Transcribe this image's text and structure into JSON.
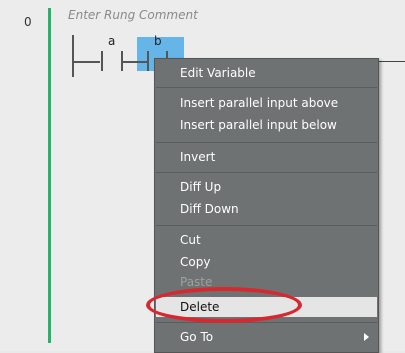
{
  "ladder": {
    "rung_number": "0",
    "rung_comment_placeholder": "Enter Rung Comment",
    "contact_a_label": "a",
    "contact_b_label": "b"
  },
  "context_menu": {
    "items": [
      {
        "label": "Edit Variable",
        "enabled": true
      },
      {
        "label": "Insert parallel input above",
        "enabled": true
      },
      {
        "label": "Insert parallel input below",
        "enabled": true
      },
      {
        "label": "Invert",
        "enabled": true
      },
      {
        "label": "Diff Up",
        "enabled": true
      },
      {
        "label": "Diff Down",
        "enabled": true
      },
      {
        "label": "Cut",
        "enabled": true
      },
      {
        "label": "Copy",
        "enabled": true
      },
      {
        "label": "Paste",
        "enabled": false
      },
      {
        "label": "Delete",
        "enabled": true,
        "highlighted": true
      },
      {
        "label": "Go To",
        "enabled": true,
        "submenu": true
      }
    ]
  },
  "colors": {
    "selection": "#65b5e9",
    "rung_marker": "#23b46a",
    "menu_background": "#6f7273",
    "annotation_ellipse": "#d72830"
  }
}
